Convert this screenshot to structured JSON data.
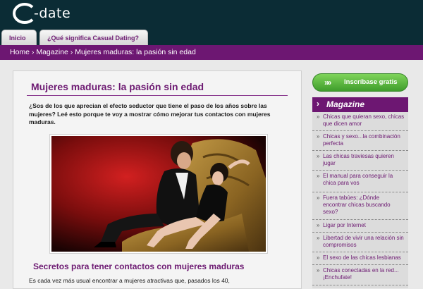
{
  "logo": {
    "letter": "C",
    "word": "-date"
  },
  "tabs": [
    {
      "label": "Inicio"
    },
    {
      "label": "¿Qué significa Casual Dating?"
    }
  ],
  "breadcrumb": "Home › Magazine › Mujeres maduras: la pasión sin edad",
  "article": {
    "title": "Mujeres maduras: la pasión sin edad",
    "intro": "¿Sos de los que aprecian el efecto seductor que tiene el paso de los años sobre las mujeres? Leé esto porque te voy a mostrar cómo mejorar tus contactos con mujeres maduras.",
    "section_title": "Secretos para tener contactos con mujeres maduras",
    "body_start": "Es cada vez más usual encontrar a mujeres atractivas que, pasados los 40,"
  },
  "sidebar": {
    "signup_label": "Inscríbase gratis",
    "signup_arrows": "»»",
    "magazine_label": "Magazine",
    "magazine_arrow": "›",
    "items": [
      {
        "label": "Chicas que quieran sexo, chicas que dicen amor"
      },
      {
        "label": "Chicas y sexo...la combinación perfecta"
      },
      {
        "label": "Las chicas traviesas quieren jugar"
      },
      {
        "label": "El manual para conseguir la chica para vos"
      },
      {
        "label": "Fuera tabúes: ¿Dónde encontrar chicas buscando sexo?"
      },
      {
        "label": "Ligar por Internet"
      },
      {
        "label": "Libertad de vivir una relación sin compromisos"
      },
      {
        "label": "El sexo de las chicas lesbianas"
      },
      {
        "label": "Chicas conectadas en la red... ¡Enchufate!"
      }
    ]
  },
  "colors": {
    "header_bg": "#0b2c35",
    "brand_purple": "#6d1772",
    "signup_green": "#4fae36"
  }
}
